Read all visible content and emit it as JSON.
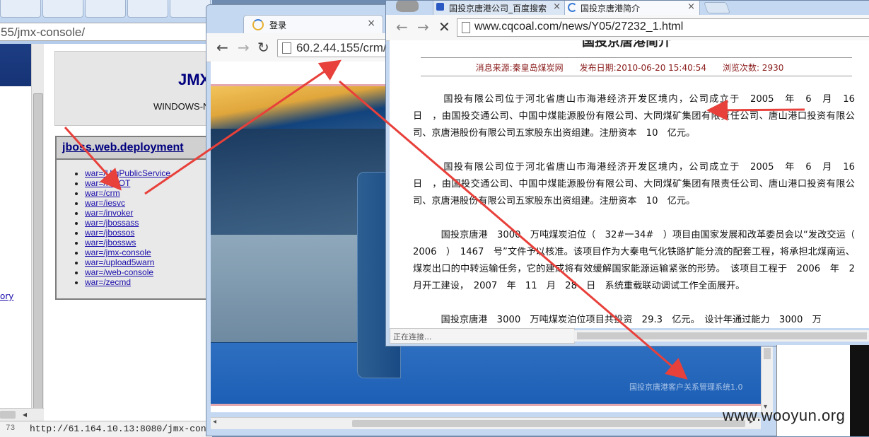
{
  "back_window": {
    "url": "55/jmx-console/",
    "jmx_title": "JMX",
    "jmx_subtitle": "WINDOWS-N",
    "left_link": "ory",
    "deployment_heading": "jboss.web.deployment",
    "deployments": [
      "war=/UtgPublicService",
      "war=/ROOT",
      "war=/crm",
      "war=/iesvc",
      "war=/invoker",
      "war=/jbossass",
      "war=/jbossos",
      "war=/jbossws",
      "war=/jmx-console",
      "war=/upload5warn",
      "war=/web-console",
      "war=/zecmd"
    ],
    "status_number": "73",
    "status_url": "http://61.164.10.13:8080/jmx-con"
  },
  "login_window": {
    "tab_title": "登录",
    "url": "60.2.44.155/crm/",
    "footer_text": "国投京唐港客户关系管理系统1.0"
  },
  "news_window": {
    "tabs": [
      {
        "title": "国投京唐港公司_百度搜索"
      },
      {
        "title": "国投京唐港简介"
      }
    ],
    "url": "www.cqcoal.com/news/Y05/27232_1.html",
    "page_title": "国投京唐港简介",
    "meta_line": "消息来源:秦皇岛煤炭网      发布日期:2010-06-20 15:40:54      浏览次数: 2930",
    "paragraphs": [
      "　　　国投有限公司位于河北省唐山市海港经济开发区境内，公司成立于　2005　年　6　月　16　日　，由国投交通公司、中国中煤能源股份有限公司、大同煤矿集团有限责任公司、唐山港口投资有限公司、京唐港股份有限公司五家股东出资组建。注册资本　10　亿元。",
      "　　　国投有限公司位于河北省唐山市海港经济开发区境内，公司成立于　2005　年　6　月　16　日　，由国投交通公司、中国中煤能源股份有限公司、大同煤矿集团有限责任公司、唐山港口投资有限公司、京唐港股份有限公司五家股东出资组建。注册资本　10　亿元。",
      "　　　国投京唐港　3000　万吨煤炭泊位（　32#一34#　）项目由国家发展和改革委员会以“发改交运（　2006　）　1467　号”文件予以核准。该项目作为大秦电气化铁路扩能分流的配套工程，将承担北煤南运、煤炭出口的中转运输任务，它的建成将有效缓解国家能源运输紧张的形势。　该项目工程于　2006　年　2　月开工建设，　2007　年　11　月　28　日　系统重载联动调试工作全面展开。",
      "　　　国投京唐港　3000　万吨煤炭泊位项目共投资　29.3　亿元。　设计年通过能力　3000　万"
    ],
    "status_text": "正在连接..."
  },
  "watermark": "www.wooyun.org",
  "colors": {
    "annotation_red": "#e8403a",
    "link_blue": "#1a0dab",
    "jmx_navy": "#00007f",
    "meta_red": "#8b1c1c"
  }
}
